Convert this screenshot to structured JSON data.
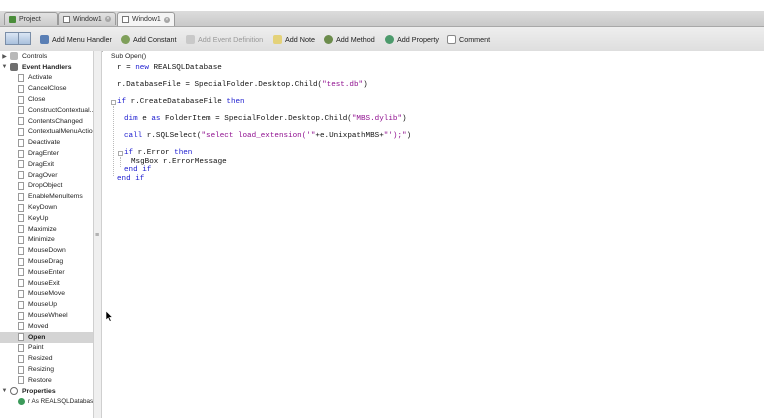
{
  "tabs": [
    {
      "label": "Project",
      "icon": "project-icon",
      "active": false
    },
    {
      "label": "Window1",
      "icon": "window-icon",
      "active": false
    },
    {
      "label": "Window1",
      "icon": "window-icon",
      "active": true
    }
  ],
  "toolbar": {
    "add_menu_handler": "Add Menu Handler",
    "add_constant": "Add Constant",
    "add_event_definition": "Add Event Definition",
    "add_note": "Add Note",
    "add_method": "Add Method",
    "add_property": "Add Property",
    "comment": "Comment"
  },
  "sidebar": {
    "controls": "Controls",
    "event_handlers": "Event Handlers",
    "events": [
      "Activate",
      "CancelClose",
      "Close",
      "ConstructContextual...",
      "ContentsChanged",
      "ContextualMenuAction",
      "Deactivate",
      "DragEnter",
      "DragExit",
      "DragOver",
      "DropObject",
      "EnableMenuItems",
      "KeyDown",
      "KeyUp",
      "Maximize",
      "Minimize",
      "MouseDown",
      "MouseDrag",
      "MouseEnter",
      "MouseExit",
      "MouseMove",
      "MouseUp",
      "MouseWheel",
      "Moved",
      "Open",
      "Paint",
      "Resized",
      "Resizing",
      "Restore"
    ],
    "selected": "Open",
    "properties": "Properties",
    "property_item": "r As REALSQLDatabase"
  },
  "editor": {
    "header": "Sub Open()",
    "lines": [
      {
        "indent": 0,
        "parts": [
          [
            "t",
            "r = "
          ],
          [
            "k",
            "new"
          ],
          [
            "t",
            " REALSQLDatabase"
          ]
        ]
      },
      {
        "indent": 0,
        "parts": [
          [
            "t",
            "r.DatabaseFile = SpecialFolder.Desktop.Child("
          ],
          [
            "s",
            "\"test.db\""
          ],
          [
            "t",
            ")"
          ]
        ]
      },
      {
        "indent": 0,
        "parts": [
          [
            "k",
            "if"
          ],
          [
            "t",
            " r.CreateDatabaseFile "
          ],
          [
            "k",
            "then"
          ]
        ]
      },
      {
        "indent": 1,
        "parts": [
          [
            "k",
            "dim"
          ],
          [
            "t",
            " e "
          ],
          [
            "k",
            "as"
          ],
          [
            "t",
            " FolderItem = SpecialFolder.Desktop.Child("
          ],
          [
            "s",
            "\"MBS.dylib\""
          ],
          [
            "t",
            ")"
          ]
        ]
      },
      {
        "indent": 1,
        "parts": [
          [
            "k",
            "call"
          ],
          [
            "t",
            " r.SQLSelect("
          ],
          [
            "s",
            "\"select load_extension('\""
          ],
          [
            "t",
            "+e.UnixpathMBS+"
          ],
          [
            "s",
            "\"');\""
          ],
          [
            "t",
            ")"
          ]
        ]
      },
      {
        "indent": 1,
        "parts": [
          [
            "k",
            "if"
          ],
          [
            "t",
            " r.Error "
          ],
          [
            "k",
            "then"
          ]
        ]
      },
      {
        "indent": 2,
        "parts": [
          [
            "t",
            "MsgBox r.ErrorMessage"
          ]
        ]
      },
      {
        "indent": 1,
        "parts": [
          [
            "k",
            "end if"
          ]
        ]
      },
      {
        "indent": 0,
        "parts": [
          [
            "k",
            "end if"
          ]
        ]
      }
    ]
  },
  "colors": {
    "keyword": "#1c1ccf",
    "string": "#8f0f8f",
    "selection": "#d4d4d4"
  }
}
